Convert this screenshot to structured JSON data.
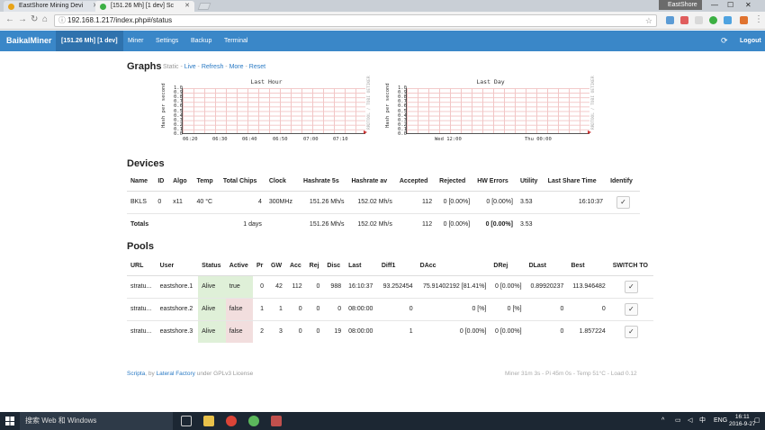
{
  "browser": {
    "tabs": [
      {
        "title": "EastShore Mining Devi",
        "favicon_color": "#e8a317"
      },
      {
        "title": "[151.26 Mh] [1 dev] Sc",
        "favicon_color": "#3cb043"
      }
    ],
    "profile": "EastShore",
    "url": "192.168.1.217/index.php#/status"
  },
  "navbar": {
    "brand": "BaikalMiner",
    "hashrate_label": "[151.26 Mh] [1 dev]",
    "items": [
      "Miner",
      "Settings",
      "Backup",
      "Terminal"
    ],
    "logout": "Logout"
  },
  "graphs": {
    "heading": "Graphs",
    "static_label": "Static",
    "links": [
      "Live",
      "Refresh",
      "More",
      "Reset"
    ],
    "separator": " - ",
    "hour": {
      "title": "Last Hour",
      "ylabel": "Hash per second",
      "side_label": "RRDTOOL / TOBI OETIKER",
      "yticks": [
        "1.0",
        "0.9",
        "0.8",
        "0.7",
        "0.6",
        "0.5",
        "0.4",
        "0.3",
        "0.2",
        "0.1",
        "0.0"
      ],
      "xticks": [
        "06:20",
        "06:30",
        "06:40",
        "06:50",
        "07:00",
        "07:10"
      ]
    },
    "day": {
      "title": "Last Day",
      "ylabel": "Hash per second",
      "side_label": "RRDTOOL / TOBI OETIKER",
      "yticks": [
        "1.0",
        "0.9",
        "0.8",
        "0.7",
        "0.6",
        "0.5",
        "0.4",
        "0.3",
        "0.2",
        "0.1",
        "0.0"
      ],
      "xticks": [
        "Wed 12:00",
        "Thu 00:00"
      ]
    }
  },
  "devices": {
    "heading": "Devices",
    "columns": [
      "Name",
      "ID",
      "Algo",
      "Temp",
      "Total Chips",
      "Clock",
      "Hashrate 5s",
      "Hashrate av",
      "Accepted",
      "Rejected",
      "HW Errors",
      "Utility",
      "Last Share Time",
      "Identify"
    ],
    "row": {
      "name": "BKLS",
      "id": "0",
      "algo": "x11",
      "temp": "40 °C",
      "chips": "4",
      "clock": "300MHz",
      "h5s": "151.26 Mh/s",
      "hav": "152.02 Mh/s",
      "accepted": "112",
      "rejected": "0 [0.00%]",
      "hw": "0 [0.00%]",
      "utility": "3.53",
      "last_share": "16:10:37",
      "identify": "✓"
    },
    "total": {
      "label": "Totals",
      "chips": "1 days",
      "h5s": "151.26 Mh/s",
      "hav": "152.02 Mh/s",
      "accepted": "112",
      "rejected": "0 [0.00%]",
      "hw": "0 [0.00%]",
      "utility": "3.53"
    }
  },
  "pools": {
    "heading": "Pools",
    "columns": [
      "URL",
      "User",
      "Status",
      "Active",
      "Pr",
      "GW",
      "Acc",
      "Rej",
      "Disc",
      "Last",
      "Diff1",
      "DAcc",
      "DRej",
      "DLast",
      "Best",
      "SWITCH TO"
    ],
    "rows": [
      {
        "url": "stratu...",
        "user": "eastshore.1",
        "status": "Alive",
        "active": "true",
        "pr": "0",
        "gw": "42",
        "acc": "112",
        "rej": "0",
        "disc": "988",
        "last": "16:10:37",
        "diff1": "93.252454",
        "dacc": "75.91402192 [81.41%]",
        "drej": "0 [0.00%]",
        "dlast": "0.89920237",
        "best": "113.946482",
        "switch": "✓"
      },
      {
        "url": "stratu...",
        "user": "eastshore.2",
        "status": "Alive",
        "active": "false",
        "pr": "1",
        "gw": "1",
        "acc": "0",
        "rej": "0",
        "disc": "0",
        "last": "08:00:00",
        "diff1": "0",
        "dacc": "0 [%]",
        "drej": "0 [%]",
        "dlast": "0",
        "best": "0",
        "switch": "✓"
      },
      {
        "url": "stratu...",
        "user": "eastshore.3",
        "status": "Alive",
        "active": "false",
        "pr": "2",
        "gw": "3",
        "acc": "0",
        "rej": "0",
        "disc": "19",
        "last": "08:00:00",
        "diff1": "1",
        "dacc": "0 [0.00%]",
        "drej": "0 [0.00%]",
        "dlast": "0",
        "best": "1.857224",
        "switch": "✓"
      }
    ]
  },
  "footer": {
    "scripta": "Scripta",
    "by": ", by",
    "lateral": "Lateral Factory",
    "license": "under GPLv3 License",
    "stats": "Miner 31m 3s  -  Pi 45m 0s  -  Temp 51°C  -  Load 0.12"
  },
  "taskbar": {
    "search": "搜索 Web 和 Windows",
    "lang": "ENG",
    "time": "16:11",
    "date": "2016-9-27"
  }
}
